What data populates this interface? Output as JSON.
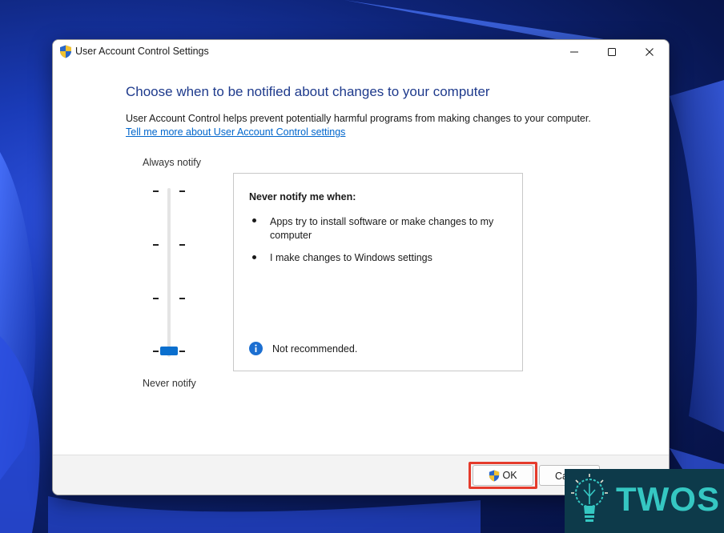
{
  "window": {
    "title": "User Account Control Settings",
    "controls": {
      "minimize": "minimize",
      "maximize": "maximize",
      "close": "close"
    }
  },
  "content": {
    "heading": "Choose when to be notified about changes to your computer",
    "description": "User Account Control helps prevent potentially harmful programs from making changes to your computer.",
    "learn_more_link": "Tell me more about User Account Control settings"
  },
  "slider": {
    "top_label": "Always notify",
    "bottom_label": "Never notify",
    "levels": 4,
    "selected_level": 1,
    "accent_color": "#0a6fce"
  },
  "info_box": {
    "title": "Never notify me when:",
    "bullets": [
      "Apps try to install software or make changes to my computer",
      "I make changes to Windows settings"
    ],
    "note": "Not recommended."
  },
  "footer": {
    "ok_label": "OK",
    "cancel_label": "Ca",
    "highlight_color": "#e53b2c"
  },
  "watermark": {
    "brand": "TWOS"
  }
}
